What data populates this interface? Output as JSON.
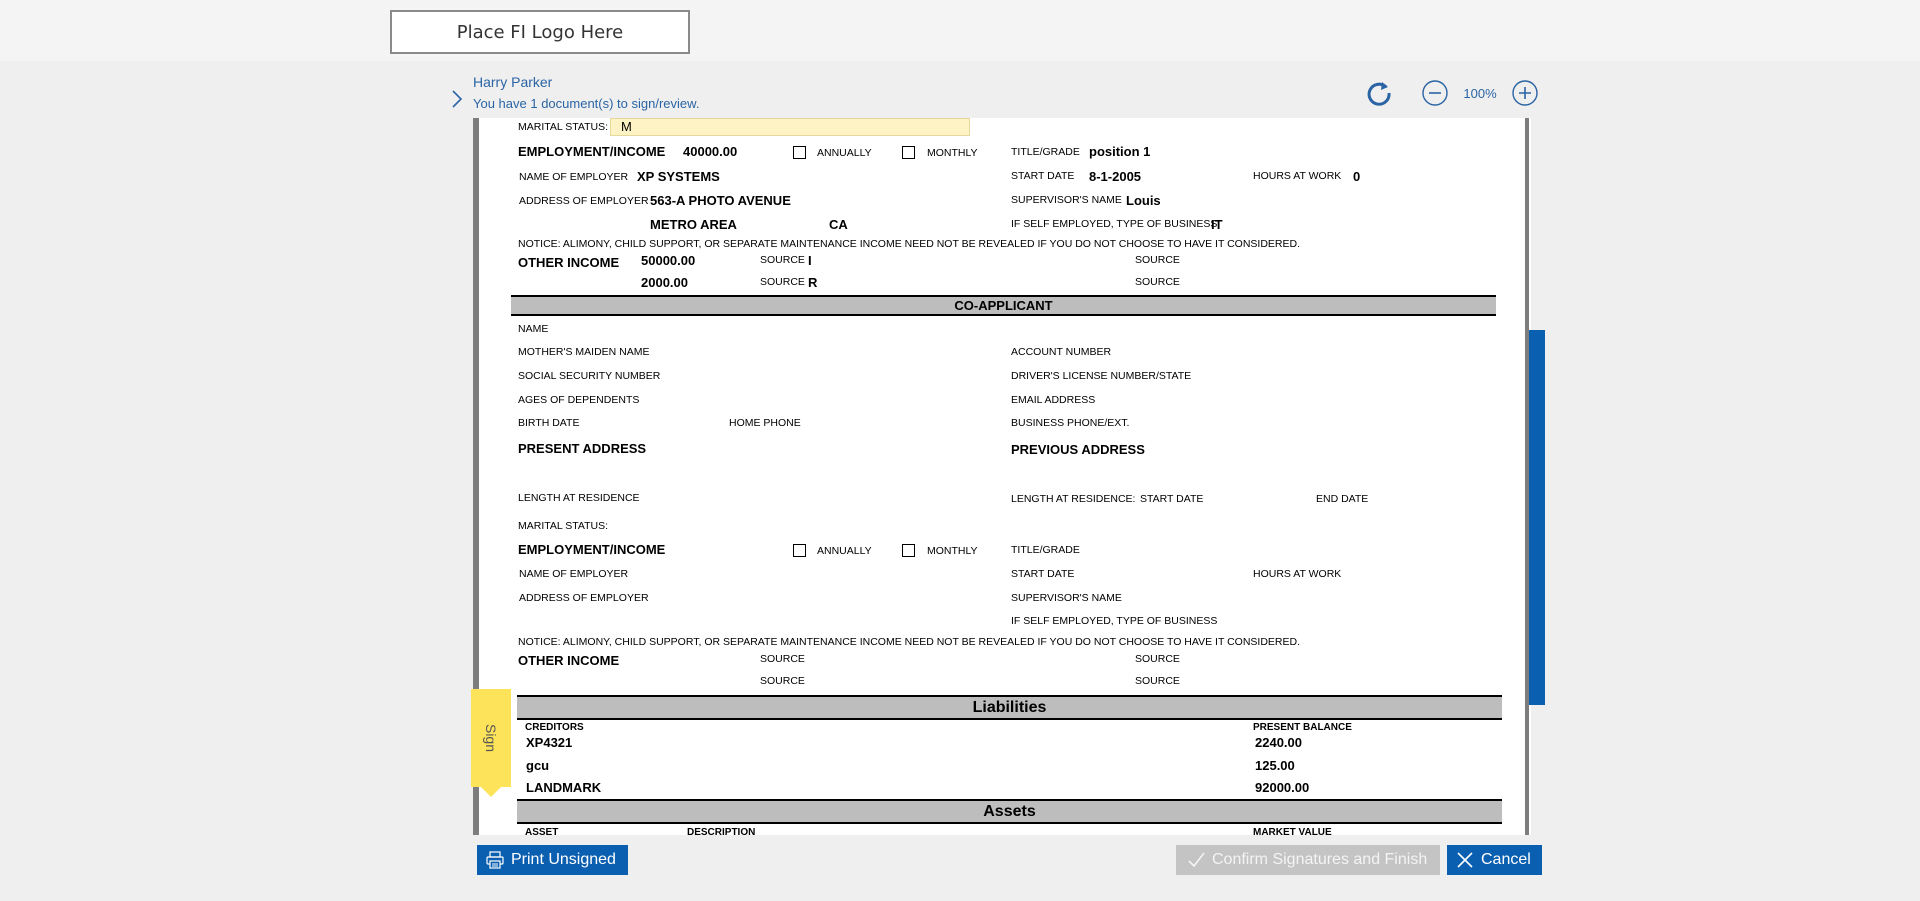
{
  "logo": {
    "text": "Place FI Logo Here"
  },
  "header": {
    "user_name": "Harry Parker",
    "doc_count": "You have 1 document(s) to sign/review.",
    "zoom": "100%"
  },
  "applicant": {
    "marital_status_label": "MARITAL STATUS:",
    "marital_status_value": "M",
    "employment_label": "EMPLOYMENT/INCOME",
    "employment_value": "40000.00",
    "annually": "ANNUALLY",
    "monthly": "MONTHLY",
    "title_label": "TITLE/GRADE",
    "title_value": "position 1",
    "employer_label": "NAME OF EMPLOYER",
    "employer_value": "XP SYSTEMS",
    "start_label": "START DATE",
    "start_value": "8-1-2005",
    "hours_label": "HOURS AT WORK",
    "hours_value": "0",
    "address_label": "ADDRESS OF EMPLOYER",
    "address_value": "563-A PHOTO AVENUE",
    "supervisor_label": "SUPERVISOR'S NAME",
    "supervisor_value": "Louis",
    "city_value": "METRO AREA",
    "state_value": "CA",
    "self_emp_label": "IF SELF EMPLOYED, TYPE OF BUSINESS",
    "self_emp_value": "IT",
    "notice": "NOTICE: ALIMONY, CHILD SUPPORT, OR SEPARATE MAINTENANCE INCOME NEED NOT BE REVEALED IF YOU DO NOT CHOOSE TO HAVE IT CONSIDERED.",
    "other_income_label": "OTHER INCOME",
    "other_income_1": "50000.00",
    "other_income_2": "2000.00",
    "source_label": "SOURCE",
    "source_1": "I",
    "source_2": "R"
  },
  "co_applicant": {
    "title": "CO-APPLICANT",
    "name": "NAME",
    "maiden": "MOTHER'S MAIDEN NAME",
    "account": "ACCOUNT NUMBER",
    "ssn": "SOCIAL SECURITY NUMBER",
    "license": "DRIVER'S LICENSE NUMBER/STATE",
    "dependents": "AGES OF DEPENDENTS",
    "email": "EMAIL ADDRESS",
    "birth": "BIRTH DATE",
    "home_phone": "HOME PHONE",
    "business_phone": "BUSINESS PHONE/EXT.",
    "present_address": "PRESENT ADDRESS",
    "previous_address": "PREVIOUS ADDRESS",
    "length_residence": "LENGTH AT RESIDENCE",
    "length_residence2": "LENGTH AT RESIDENCE:",
    "start_date": "START DATE",
    "end_date": "END DATE",
    "marital": "MARITAL STATUS:",
    "employment": "EMPLOYMENT/INCOME",
    "annually": "ANNUALLY",
    "monthly": "MONTHLY",
    "title_grade": "TITLE/GRADE",
    "employer": "NAME OF EMPLOYER",
    "start": "START DATE",
    "hours": "HOURS AT WORK",
    "address_employer": "ADDRESS OF EMPLOYER",
    "supervisor": "SUPERVISOR'S NAME",
    "self_emp": "IF SELF EMPLOYED, TYPE OF BUSINESS",
    "notice": "NOTICE: ALIMONY, CHILD SUPPORT, OR SEPARATE MAINTENANCE INCOME NEED NOT BE REVEALED IF YOU DO NOT CHOOSE TO HAVE IT CONSIDERED.",
    "other_income": "OTHER INCOME",
    "source": "SOURCE"
  },
  "liabilities": {
    "title": "Liabilities",
    "creditors_label": "CREDITORS",
    "balance_label": "PRESENT BALANCE",
    "rows": [
      {
        "creditor": "XP4321",
        "balance": "2240.00"
      },
      {
        "creditor": "gcu",
        "balance": "125.00"
      },
      {
        "creditor": "LANDMARK",
        "balance": "92000.00"
      }
    ]
  },
  "assets": {
    "title": "Assets",
    "asset_label": "ASSET",
    "description_label": "DESCRIPTION",
    "market_label": "MARKET VALUE"
  },
  "sign_tab": "Sign",
  "buttons": {
    "print": "Print Unsigned",
    "confirm": "Confirm Signatures and Finish",
    "cancel": "Cancel"
  }
}
